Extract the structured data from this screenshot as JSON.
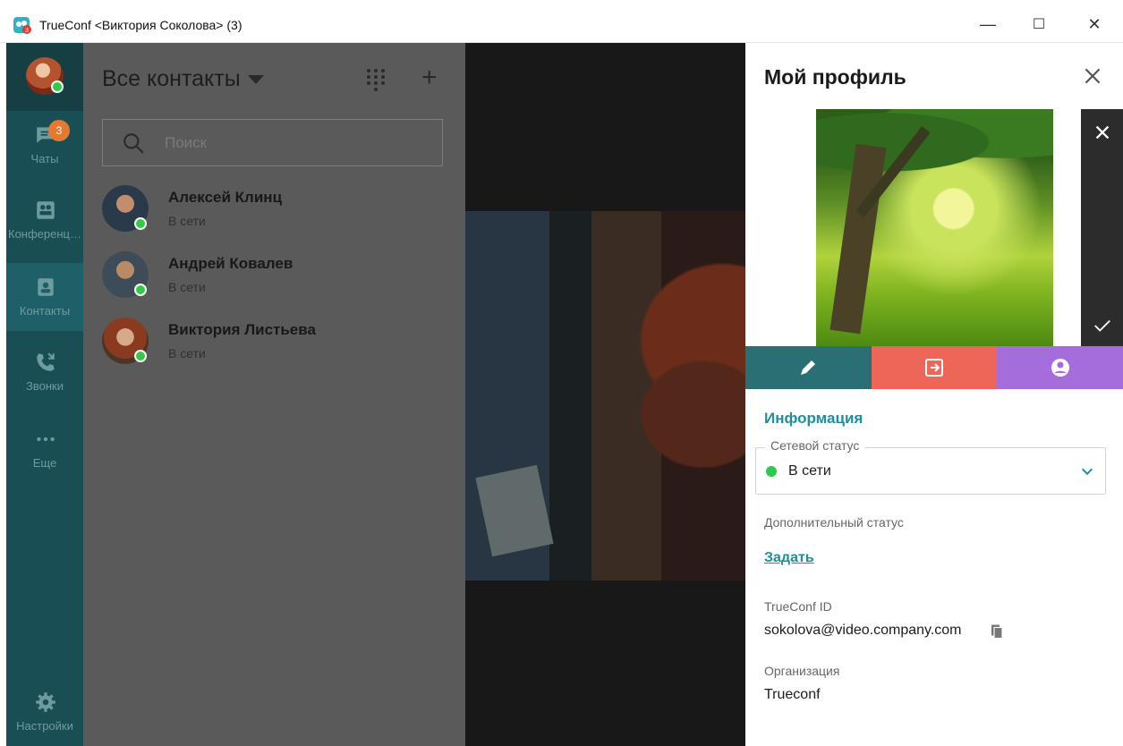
{
  "window": {
    "title": "TrueConf <Виктория Соколова> (3)",
    "minimize": "—",
    "maximize": "☐",
    "close": "✕"
  },
  "nav": {
    "items": [
      {
        "label": "Чаты",
        "icon": "chat-icon",
        "badge": "3"
      },
      {
        "label": "Конференции",
        "icon": "conference-icon"
      },
      {
        "label": "Контакты",
        "icon": "contacts-icon",
        "active": true
      },
      {
        "label": "Звонки",
        "icon": "calls-icon"
      },
      {
        "label": "Еще",
        "icon": "more-icon"
      },
      {
        "label": "Настройки",
        "icon": "gear-icon"
      }
    ]
  },
  "contacts": {
    "header": "Все контакты",
    "search_placeholder": "Поиск",
    "list": [
      {
        "name": "Алексей Клинц",
        "status": "В сети"
      },
      {
        "name": "Андрей Ковалев",
        "status": "В сети"
      },
      {
        "name": "Виктория Листьева",
        "status": "В сети"
      }
    ]
  },
  "profile": {
    "title": "Мой профиль",
    "section": "Информация",
    "network_status_label": "Сетевой статус",
    "network_status_value": "В сети",
    "extra_status_label": "Дополнительный статус",
    "extra_status_link": "Задать",
    "trueconf_id_label": "TrueConf ID",
    "trueconf_id_value": "sokolova@video.company.com",
    "org_label": "Организация",
    "org_value": "Trueconf"
  },
  "colors": {
    "rail": "#1a4e55",
    "accent": "#1e8f9b",
    "online": "#35c94a",
    "badge": "#e47a31",
    "edit": "#2a6f74",
    "exit": "#ee6658",
    "user": "#a46ddb"
  }
}
